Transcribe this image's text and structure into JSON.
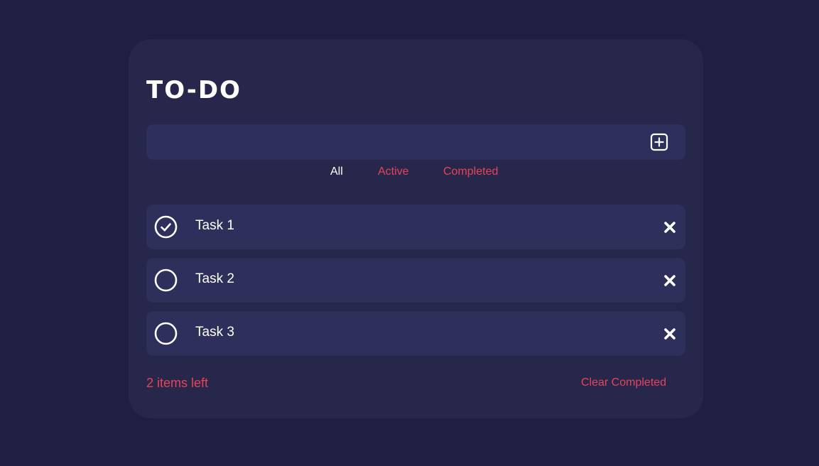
{
  "app": {
    "title": "TO-DO"
  },
  "input": {
    "value": "",
    "placeholder": "",
    "add_icon": "plus-square-icon"
  },
  "filters": {
    "all": "All",
    "active": "Active",
    "completed": "Completed",
    "selected": "All"
  },
  "tasks": [
    {
      "label": "Task 1",
      "completed": true
    },
    {
      "label": "Task 2",
      "completed": false
    },
    {
      "label": "Task 3",
      "completed": false
    }
  ],
  "footer": {
    "items_left": "2 items left",
    "clear_completed": "Clear Completed"
  },
  "colors": {
    "background": "#1e1f42",
    "card": "#26274a",
    "field": "#2e2f5a",
    "accent": "#e8435a",
    "text": "#ffffff"
  }
}
